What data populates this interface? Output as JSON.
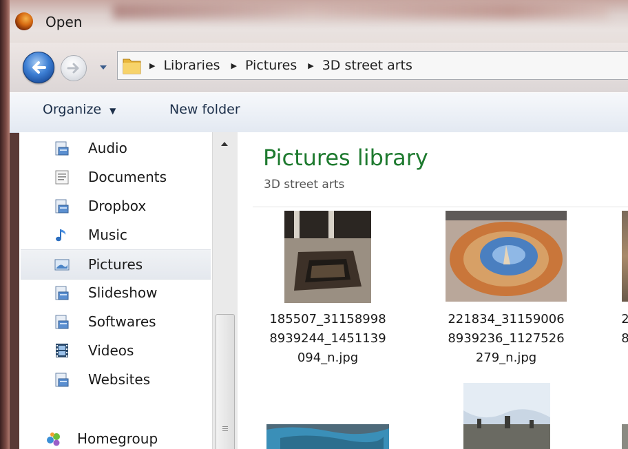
{
  "window": {
    "title": "Open",
    "app_icon": "firefox-icon"
  },
  "navigation": {
    "back_icon": "back-arrow-icon",
    "forward_icon": "forward-arrow-icon",
    "history_icon": "chevron-down-icon"
  },
  "address_bar": {
    "folder_icon": "folder-icon",
    "breadcrumbs": [
      "Libraries",
      "Pictures",
      "3D street arts"
    ]
  },
  "toolbar": {
    "organize_label": "Organize",
    "new_folder_label": "New folder"
  },
  "sidebar": {
    "items": [
      {
        "label": "Audio",
        "icon": "library-icon"
      },
      {
        "label": "Documents",
        "icon": "documents-icon"
      },
      {
        "label": "Dropbox",
        "icon": "library-icon"
      },
      {
        "label": "Music",
        "icon": "music-note-icon"
      },
      {
        "label": "Pictures",
        "icon": "pictures-icon",
        "selected": true
      },
      {
        "label": "Slideshow",
        "icon": "library-icon"
      },
      {
        "label": "Softwares",
        "icon": "library-icon"
      },
      {
        "label": "Videos",
        "icon": "film-icon"
      },
      {
        "label": "Websites",
        "icon": "library-icon"
      },
      {
        "label": "Homegroup",
        "icon": "homegroup-icon"
      }
    ]
  },
  "main": {
    "title": "Pictures library",
    "subtitle": "3D street arts",
    "files": [
      {
        "name_lines": [
          "185507_31158998",
          "8939244_1451139",
          "094_n.jpg"
        ]
      },
      {
        "name_lines": [
          "221834_31159006",
          "8939236_1127526",
          "279_n.jpg"
        ]
      },
      {
        "name_lines": [
          "2",
          "8",
          ""
        ]
      }
    ]
  },
  "colors": {
    "library_title": "#1e7a2f",
    "selected_row": "#e7ebf0"
  }
}
